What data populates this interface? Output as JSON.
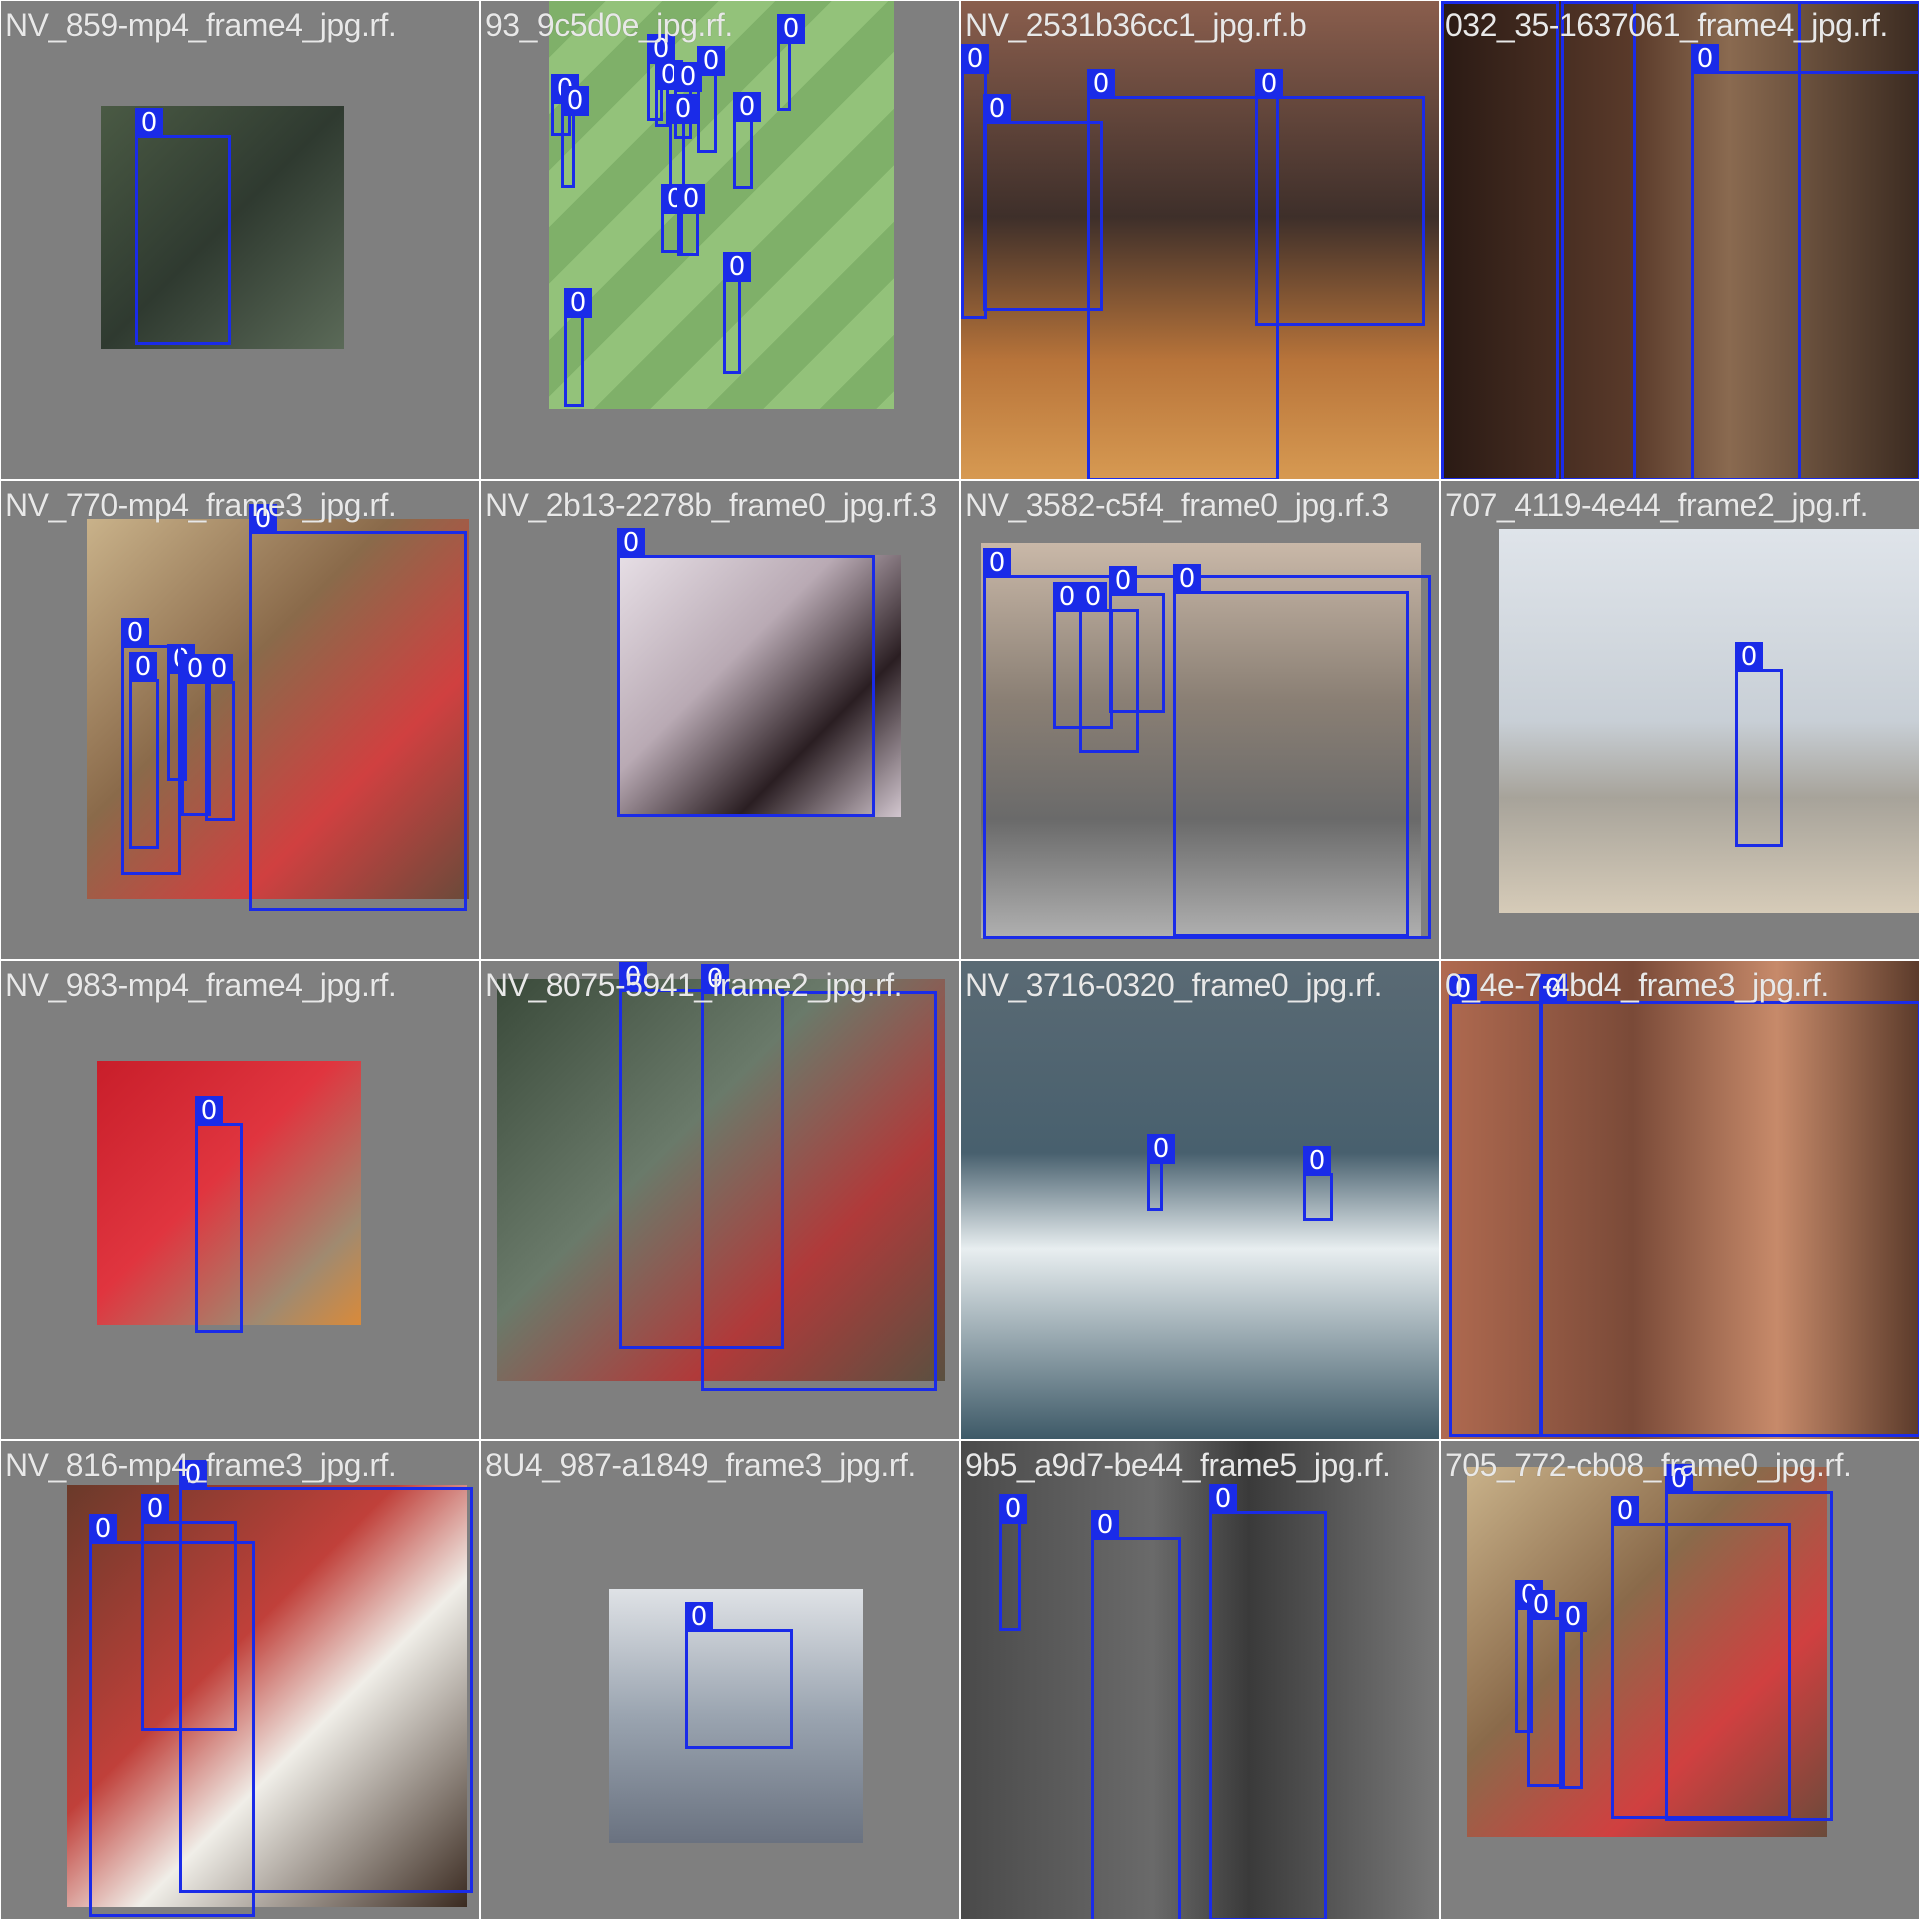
{
  "grid": {
    "rows": 4,
    "cols": 4,
    "tile_background": "#7f7f7f",
    "box_color": "#1a2be8",
    "tiles": [
      {
        "title": "NV_859-mp4_frame4_jpg.rf.",
        "boxes": [
          "0"
        ]
      },
      {
        "title": "93_9c5d0e_jpg.rf.",
        "boxes": [
          "0",
          "0",
          "0",
          "0",
          "0",
          "0",
          "0",
          "0",
          "0",
          "0",
          "0",
          "0",
          "0"
        ]
      },
      {
        "title": "NV_2531b36cc1_jpg.rf.b",
        "boxes": [
          "0",
          "0",
          "0",
          "0"
        ]
      },
      {
        "title": "032_35-1637061_frame4_jpg.rf.",
        "boxes": [
          "0",
          "0",
          "0",
          "0"
        ]
      },
      {
        "title": "NV_770-mp4_frame3_jpg.rf.",
        "boxes": [
          "0",
          "0",
          "0",
          "0",
          "0",
          "0"
        ]
      },
      {
        "title": "NV_2b13-2278b_frame0_jpg.rf.3",
        "boxes": [
          "0"
        ]
      },
      {
        "title": "NV_3582-c5f4_frame0_jpg.rf.3",
        "boxes": [
          "0",
          "0",
          "0",
          "0",
          "0"
        ]
      },
      {
        "title": "707_4119-4e44_frame2_jpg.rf.",
        "boxes": [
          "0"
        ]
      },
      {
        "title": "NV_983-mp4_frame4_jpg.rf.",
        "boxes": [
          "0"
        ]
      },
      {
        "title": "NV_8075-5941_frame2_jpg.rf.",
        "boxes": [
          "0",
          "0"
        ]
      },
      {
        "title": "NV_3716-0320_frame0_jpg.rf.",
        "boxes": [
          "0",
          "0"
        ]
      },
      {
        "title": "0_4e-7-4bd4_frame3_jpg.rf.",
        "boxes": [
          "0",
          "0"
        ]
      },
      {
        "title": "NV_816-mp4_frame3_jpg.rf.",
        "boxes": [
          "0",
          "0",
          "0"
        ]
      },
      {
        "title": "8U4_987-a1849_frame3_jpg.rf.",
        "boxes": [
          "0"
        ]
      },
      {
        "title": "9b5_a9d7-be44_frame5_jpg.rf.",
        "boxes": [
          "0",
          "0",
          "0"
        ]
      },
      {
        "title": "705_772-cb08_frame0_jpg.rf.",
        "boxes": [
          "0",
          "0",
          "0",
          "0",
          "0"
        ]
      }
    ]
  }
}
